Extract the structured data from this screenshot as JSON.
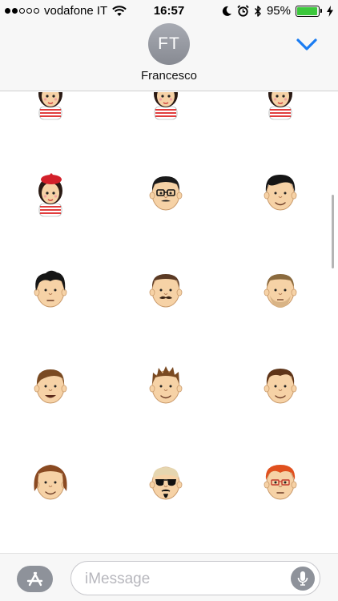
{
  "status": {
    "carrier": "vodafone IT",
    "signal_bars_filled": 2,
    "signal_bars_total": 5,
    "time": "16:57",
    "battery_percent": "95%",
    "battery_level": 0.95,
    "icons": [
      "wifi-icon",
      "moon-icon",
      "alarm-icon",
      "bluetooth-icon",
      "battery-icon",
      "charging-bolt-icon"
    ]
  },
  "header": {
    "avatar_initials": "FT",
    "contact_name": "Francesco",
    "collapse_icon": "chevron-down-icon"
  },
  "stickers": [
    {
      "name": "sticker-girl-striped-shirt"
    },
    {
      "name": "sticker-girl-striped-shirt-2"
    },
    {
      "name": "sticker-girl-striped-shirt-3"
    },
    {
      "name": "sticker-girl-red-beret"
    },
    {
      "name": "sticker-man-glasses-mustache"
    },
    {
      "name": "sticker-man-black-hair"
    },
    {
      "name": "sticker-man-black-curly-hair"
    },
    {
      "name": "sticker-man-mustache"
    },
    {
      "name": "sticker-man-beard-stubble"
    },
    {
      "name": "sticker-man-brown-hair-smile"
    },
    {
      "name": "sticker-man-spiky-hair"
    },
    {
      "name": "sticker-man-brown-hair"
    },
    {
      "name": "sticker-man-long-hair"
    },
    {
      "name": "sticker-man-sunglasses-goatee"
    },
    {
      "name": "sticker-man-red-hair-glasses"
    }
  ],
  "input": {
    "placeholder": "iMessage",
    "app_store_icon": "app-store-icon",
    "mic_icon": "microphone-icon"
  },
  "colors": {
    "accent": "#1a7cf2",
    "battery_green": "#3cc83c",
    "avatar_gray": "#8e929a",
    "skin": "#f6d2a6"
  }
}
